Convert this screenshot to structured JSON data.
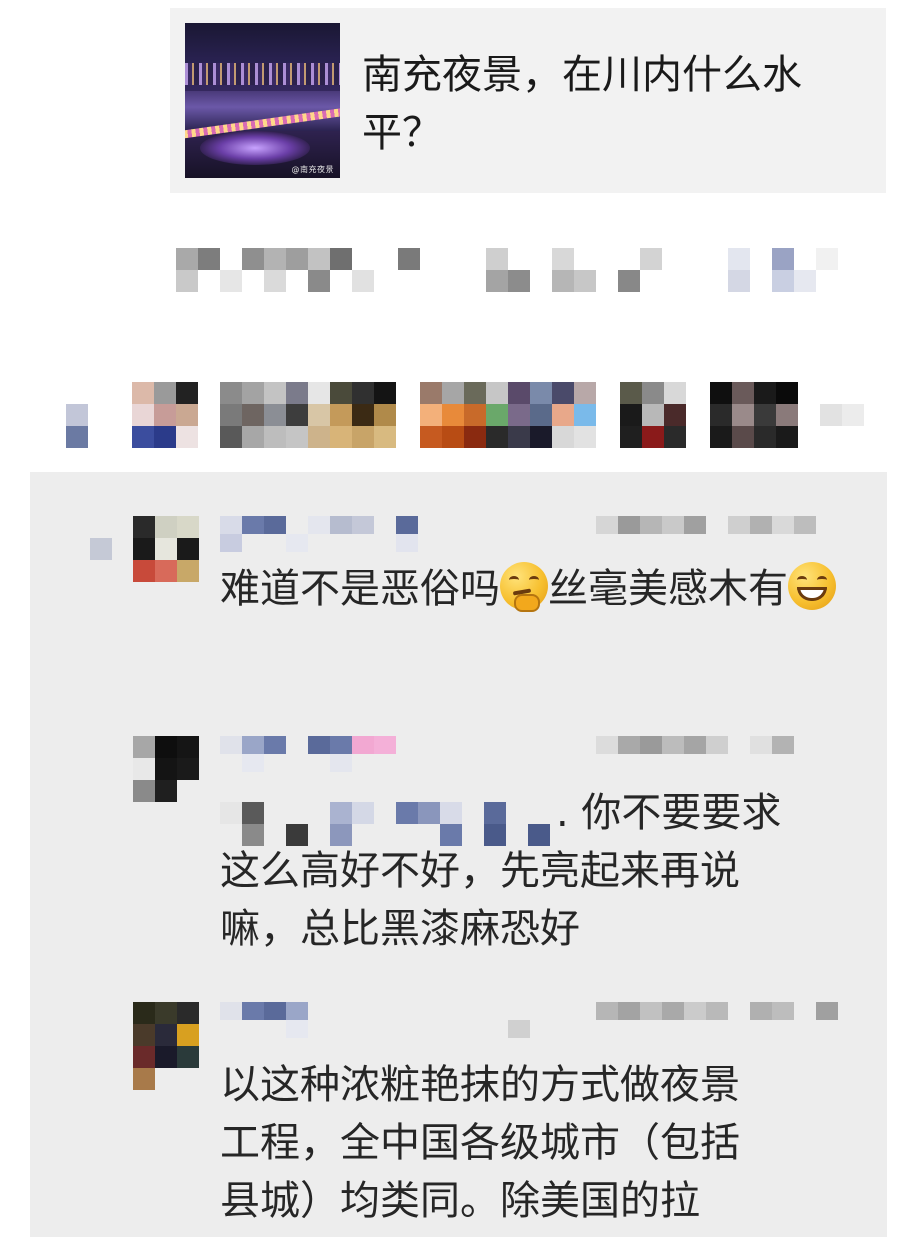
{
  "share_card": {
    "thumbnail_icon": "night-city-photo",
    "thumbnail_watermark": "@南充夜景",
    "title": "南充夜景，在川内什么水平？"
  },
  "comments": [
    {
      "text_part1": "难道不是恶俗吗",
      "emoji1": "thinking-face-icon",
      "text_part2": "丝毫美感木有",
      "emoji2": "grinning-face-icon"
    },
    {
      "text_lines": [
        ". 你不要要求",
        "这么高好不好，先亮起来再说",
        "嘛，总比黑漆麻恐好"
      ]
    },
    {
      "text_lines": [
        "以这种浓粧艳抹的方式做夜景",
        "工程，全中国各级城市（包括",
        "县城）均类同。除美国的拉"
      ]
    }
  ],
  "colors": {
    "card_background": "#f2f2f2",
    "panel_background": "#ededed",
    "text": "#262626"
  }
}
